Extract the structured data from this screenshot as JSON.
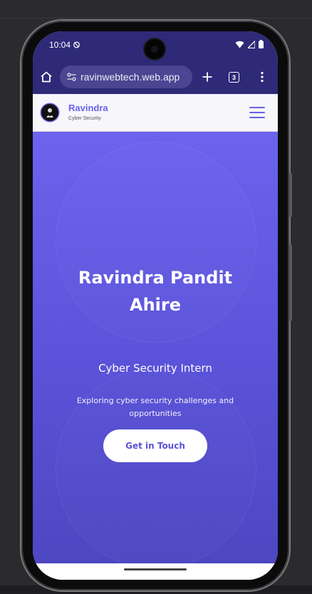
{
  "status_bar": {
    "time": "10:04",
    "icons": [
      "alarm-icon",
      "wifi-icon",
      "signal-icon",
      "battery-icon"
    ]
  },
  "browser": {
    "url": "ravinwebtech.web.app",
    "tab_count": "3",
    "icons": [
      "home-icon",
      "site-info-icon",
      "new-tab-icon",
      "tab-switcher-icon",
      "more-menu-icon"
    ]
  },
  "site_header": {
    "brand_name": "Ravindra",
    "brand_tagline": "Cyber Security",
    "menu_icon": "hamburger-icon"
  },
  "hero": {
    "title_line1": "Ravindra Pandit",
    "title_line2": "Ahire",
    "subtitle": "Cyber Security Intern",
    "description": "Exploring cyber security challenges and opportunities",
    "cta_label": "Get in Touch"
  },
  "colors": {
    "browser_bar": "#2e2a78",
    "accent": "#6a63e6",
    "hero_top": "#6c63ee",
    "hero_bottom": "#4d47c2"
  }
}
